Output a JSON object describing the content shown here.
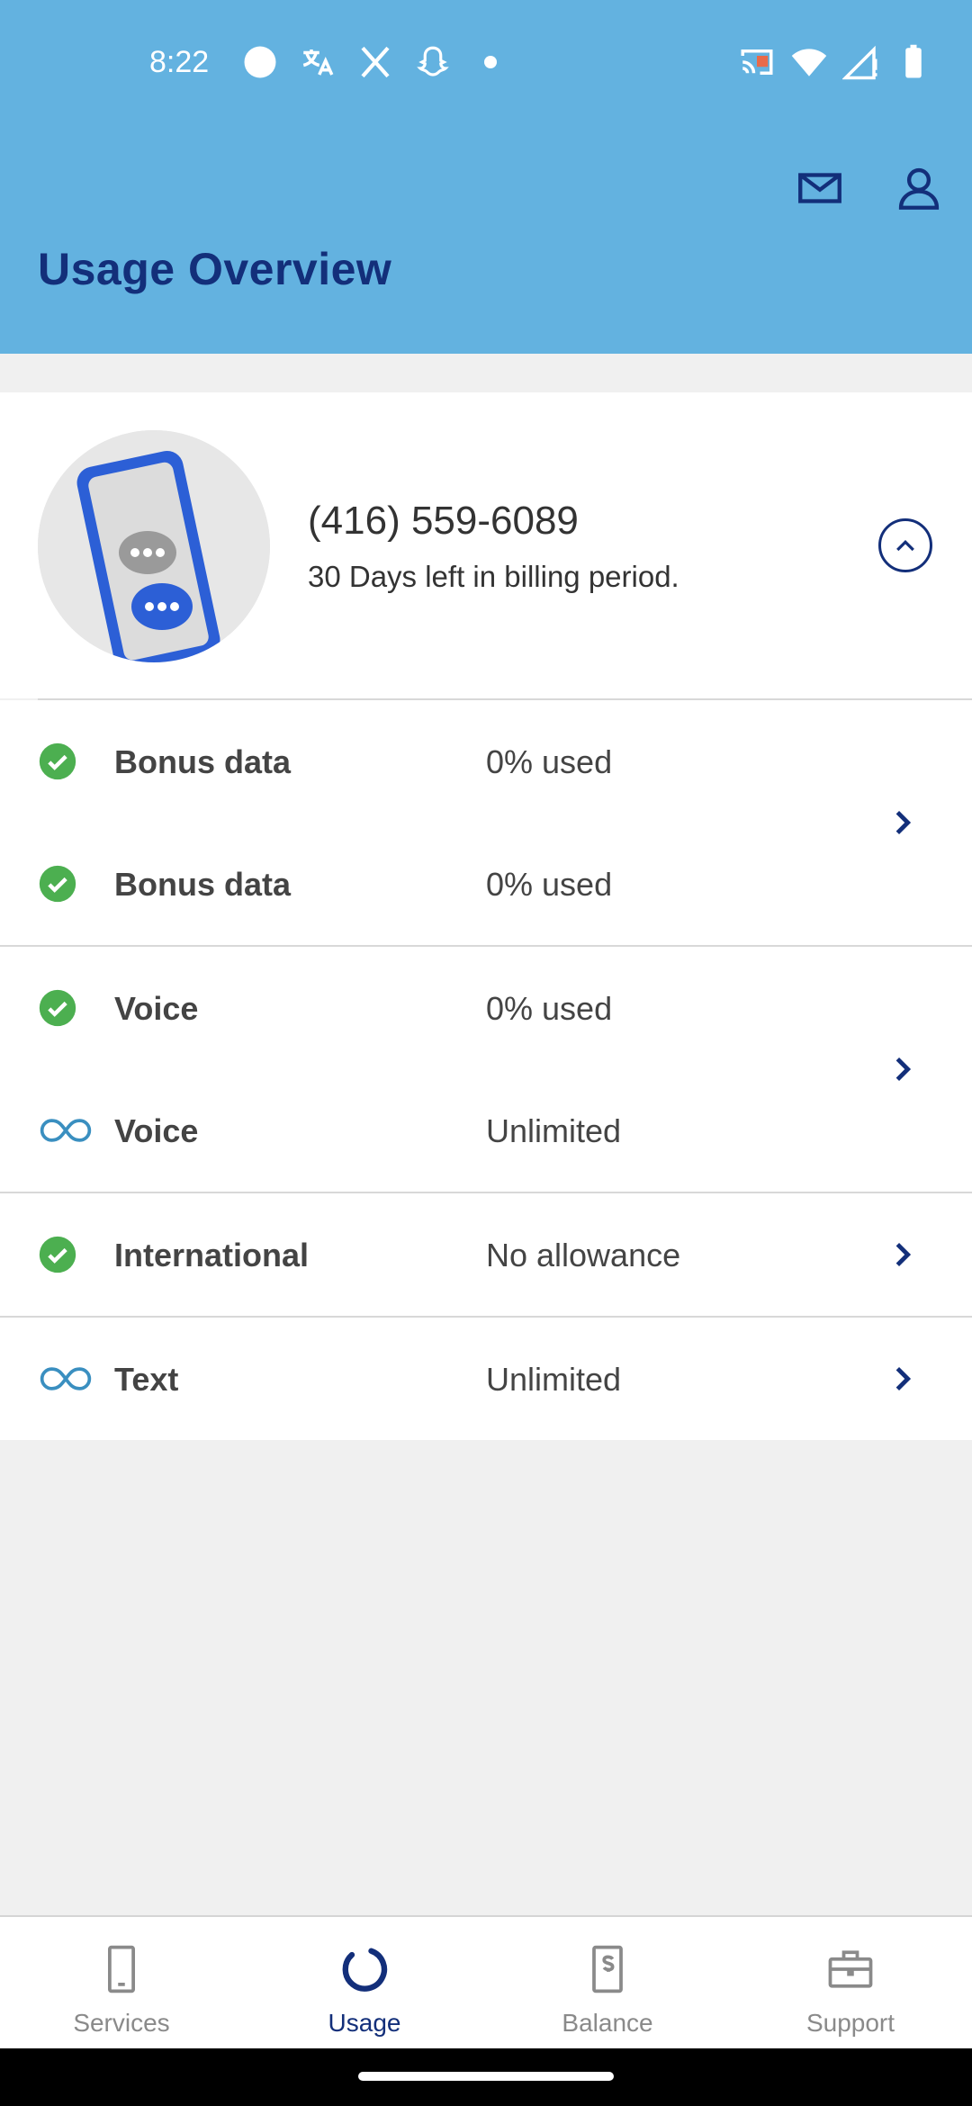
{
  "status_bar": {
    "time": "8:22"
  },
  "header": {
    "title": "Usage Overview",
    "mail_icon": "mail-icon",
    "profile_icon": "profile-icon"
  },
  "account": {
    "phone_number": "(416) 559-6089",
    "billing_text": "30 Days left in billing period."
  },
  "usage_groups": [
    {
      "rows": [
        {
          "icon": "check-circle-icon",
          "label": "Bonus data",
          "value": "0% used"
        },
        {
          "icon": "check-circle-icon",
          "label": "Bonus data",
          "value": "0% used"
        }
      ]
    },
    {
      "rows": [
        {
          "icon": "check-circle-icon",
          "label": "Voice",
          "value": "0% used"
        },
        {
          "icon": "infinity-icon",
          "label": "Voice",
          "value": "Unlimited"
        }
      ]
    },
    {
      "rows": [
        {
          "icon": "check-circle-icon",
          "label": "International",
          "value": "No allowance"
        }
      ]
    },
    {
      "rows": [
        {
          "icon": "infinity-icon",
          "label": "Text",
          "value": "Unlimited"
        }
      ]
    }
  ],
  "bottom_nav": {
    "items": [
      {
        "label": "Services",
        "icon": "phone-icon",
        "active": false
      },
      {
        "label": "Usage",
        "icon": "usage-ring-icon",
        "active": true
      },
      {
        "label": "Balance",
        "icon": "balance-icon",
        "active": false
      },
      {
        "label": "Support",
        "icon": "briefcase-icon",
        "active": false
      }
    ]
  },
  "colors": {
    "header_bg": "#63b2e0",
    "brand_navy": "#132f7a",
    "check_green": "#4caf50",
    "infinity_blue": "#3a8fc0"
  }
}
